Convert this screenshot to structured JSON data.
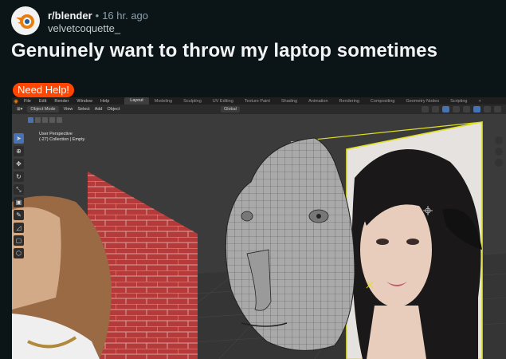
{
  "post": {
    "subreddit": "r/blender",
    "separator": "•",
    "age": "16 hr. ago",
    "author": "velvetcoquette_",
    "title": "Genuinely want to throw my laptop sometimes",
    "flair": "Need Help!"
  },
  "blender": {
    "menu": [
      "File",
      "Edit",
      "Render",
      "Window",
      "Help"
    ],
    "workspaces": [
      "Layout",
      "Modeling",
      "Sculpting",
      "UV Editing",
      "Texture Paint",
      "Shading",
      "Animation",
      "Rendering",
      "Compositing",
      "Geometry Nodes",
      "Scripting"
    ],
    "active_workspace": "Layout",
    "header": {
      "mode": "Object Mode",
      "view": "View",
      "select": "Select",
      "add": "Add",
      "object": "Object",
      "orientation": "Global"
    },
    "viewport": {
      "perspective": "User Perspective",
      "collection": "(-27) Collection | Empty"
    },
    "tools": [
      "select-tool",
      "cursor-tool",
      "move-tool",
      "rotate-tool",
      "scale-tool",
      "transform-tool",
      "annotate-tool",
      "measure-tool",
      "add-cube-tool",
      "add-object-tool"
    ]
  },
  "colors": {
    "background": "#0b1416",
    "flair": "#ff4500",
    "blender_accent": "#4772b3",
    "selection_outline": "#e0e020"
  }
}
